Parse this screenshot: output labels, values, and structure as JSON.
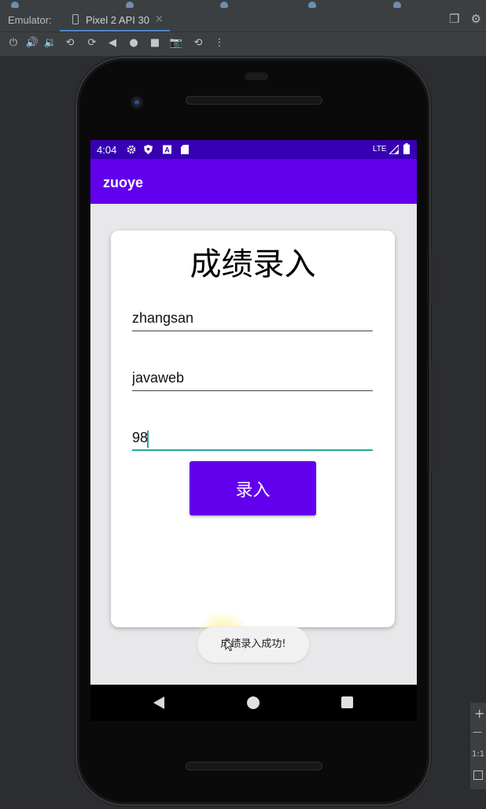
{
  "ide": {
    "emulator_label": "Emulator:",
    "device_tab": "Pixel 2 API 30",
    "tab_close": "×",
    "toolbar_icons": [
      "power-icon",
      "volume-up-icon",
      "volume-down-icon",
      "rotate-left-icon",
      "rotate-right-icon",
      "back-icon",
      "home-icon",
      "overview-icon",
      "screenshot-icon",
      "snapshot-icon",
      "more-icon"
    ],
    "right_icons": [
      "window-mode-icon",
      "settings-icon"
    ],
    "side_panel": {
      "plus": "+",
      "minus": "—",
      "ratio": "1:1"
    }
  },
  "status_bar": {
    "time": "4:04",
    "left_icons": [
      "settings-icon",
      "shield-icon",
      "a-icon",
      "sd-card-icon"
    ],
    "network": "LTE",
    "right_icons": [
      "signal-icon",
      "battery-icon"
    ],
    "color": "#3700b3"
  },
  "app_bar": {
    "title": "zuoye",
    "color": "#6200ee"
  },
  "form": {
    "title": "成绩录入",
    "fields": [
      {
        "value": "zhangsan"
      },
      {
        "value": "javaweb"
      },
      {
        "value": "98"
      }
    ],
    "submit_label": "录入",
    "accent": "#26a69a"
  },
  "toast": {
    "text": "成绩录入成功!"
  },
  "nav_bar": {
    "buttons": [
      "back",
      "home",
      "recents"
    ]
  }
}
